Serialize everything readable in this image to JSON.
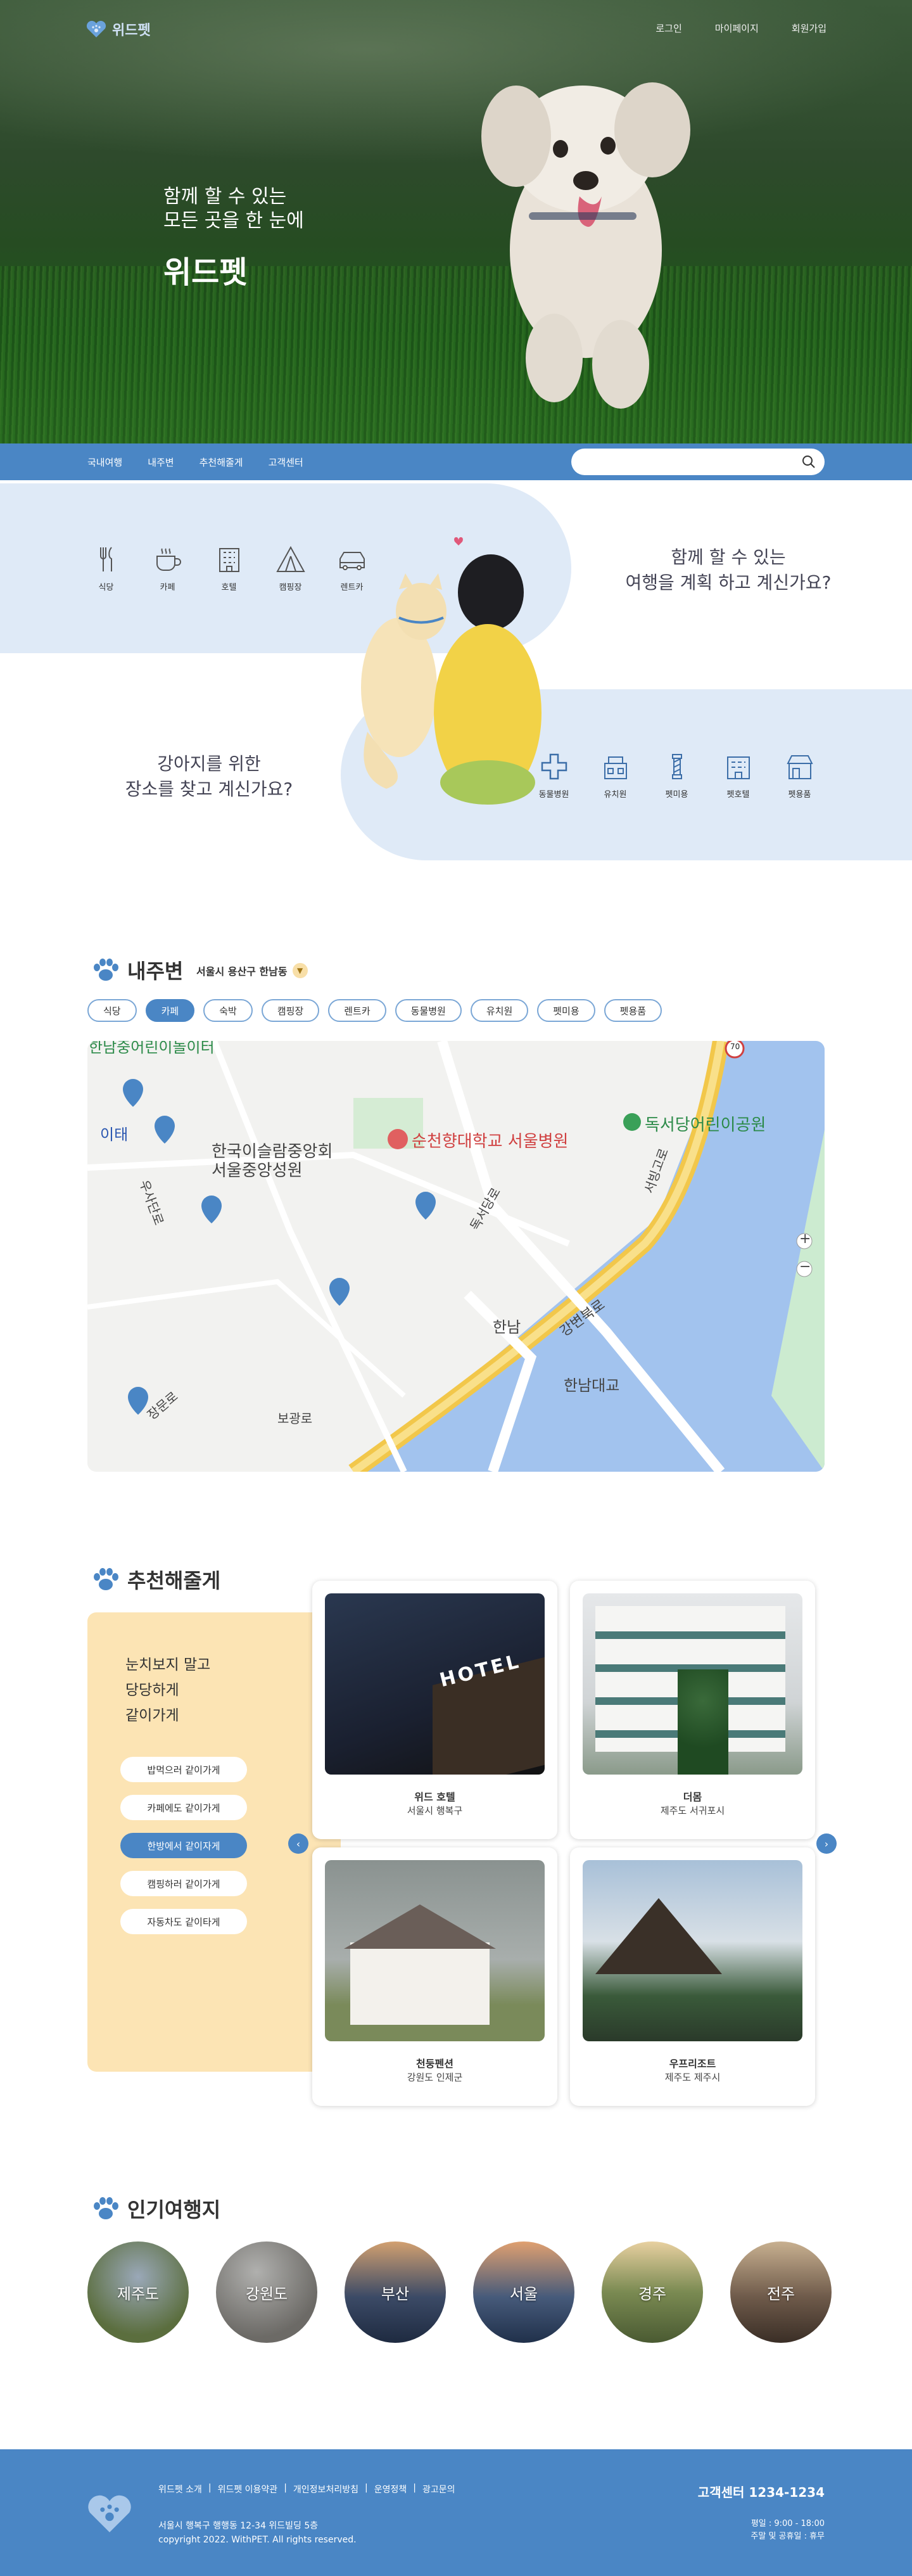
{
  "brand": {
    "name": "위드펫"
  },
  "top_nav": [
    "로그인",
    "마이페이지",
    "회원가입"
  ],
  "hero": {
    "line1": "함께 할 수 있는",
    "line2": "모든 곳을 한 눈에",
    "title": "위드펫"
  },
  "category_nav": [
    "국내여행",
    "내주변",
    "추천해줄게",
    "고객센터"
  ],
  "search": {
    "placeholder": ""
  },
  "intro": {
    "question1": [
      "함께 할 수 있는",
      "여행을 계획 하고 계신가요?"
    ],
    "question2": [
      "강아지를 위한",
      "장소를 찾고 계신가요?"
    ],
    "travel_icons": [
      {
        "label": "식당",
        "icon": "cutlery-icon"
      },
      {
        "label": "카페",
        "icon": "coffee-cup-icon"
      },
      {
        "label": "호텔",
        "icon": "hotel-icon"
      },
      {
        "label": "캠핑장",
        "icon": "tent-icon"
      },
      {
        "label": "렌트카",
        "icon": "car-icon"
      }
    ],
    "pet_icons": [
      {
        "label": "동물병원",
        "icon": "hospital-cross-icon"
      },
      {
        "label": "유치원",
        "icon": "kindergarten-icon"
      },
      {
        "label": "펫미용",
        "icon": "barber-pole-icon"
      },
      {
        "label": "펫호텔",
        "icon": "pet-hotel-icon"
      },
      {
        "label": "펫용품",
        "icon": "pet-shop-icon"
      }
    ]
  },
  "nearby": {
    "title": "내주변",
    "location": "서울시 용산구 한남동",
    "chips": [
      "식당",
      "카페",
      "숙박",
      "캠핑장",
      "렌트카",
      "동물병원",
      "유치원",
      "펫미용",
      "펫용품"
    ],
    "active_chip": "카페",
    "map_labels": {
      "hospital": "순천향대학교 서울병원",
      "mosque": "한국이슬람중앙회\n서울중앙성원",
      "park": "독서당어린이공원",
      "station1": "이태",
      "station2": "한남",
      "bridge": "한남대교",
      "road1": "강변북로",
      "road2": "독서당로",
      "road3": "우사단로",
      "road4": "보광로",
      "road5": "서빙고로",
      "road6": "장문로",
      "top_partial": "한남중어린이놀이터",
      "route": "70"
    },
    "zoom": [
      "+",
      "−"
    ]
  },
  "recommend": {
    "title": "추천해줄게",
    "slogan": [
      "눈치보지 말고",
      "당당하게",
      "같이가게"
    ],
    "buttons": [
      "밥먹으러 같이가게",
      "카페에도 같이가게",
      "한방에서 같이자게",
      "캠핑하러 같이가게",
      "자동차도 같이타게"
    ],
    "active_button": "한방에서 같이자게",
    "cards": [
      {
        "name": "위드 호텔",
        "address": "서울시 행복구",
        "sign": "HOTEL"
      },
      {
        "name": "더몸",
        "address": "제주도 서귀포시"
      },
      {
        "name": "천둥펜션",
        "address": "강원도 인제군"
      },
      {
        "name": "우프리조트",
        "address": "제주도 제주시"
      }
    ],
    "prev": "‹",
    "next": "›"
  },
  "popular": {
    "title": "인기여행지",
    "places": [
      {
        "name": "제주도",
        "color": "#5b6e3e"
      },
      {
        "name": "강원도",
        "color": "#6c6a66"
      },
      {
        "name": "부산",
        "color": "#3b4a66"
      },
      {
        "name": "서울",
        "color": "#465a7a"
      },
      {
        "name": "경주",
        "color": "#7a8a52"
      },
      {
        "name": "전주",
        "color": "#6e5a4a"
      }
    ]
  },
  "footer": {
    "links": [
      "위드펫 소개",
      "|",
      "위드펫 이용약관",
      "|",
      "개인정보처리방침",
      "|",
      "운영정책",
      "|",
      "광고문의"
    ],
    "address": "서울시 행복구 행행동 12-34 위드빌딩 5층",
    "copyright": "copyright 2022. WithPET. All rights reserved.",
    "cs": "고객센터 1234-1234",
    "hours1": "평일 : 9:00 - 18:00",
    "hours2": "주말 및 공휴일 : 휴무"
  },
  "colors": {
    "accent": "#4a86c5",
    "light_blue": "#dfeaf7",
    "cream": "#fce4b4"
  }
}
